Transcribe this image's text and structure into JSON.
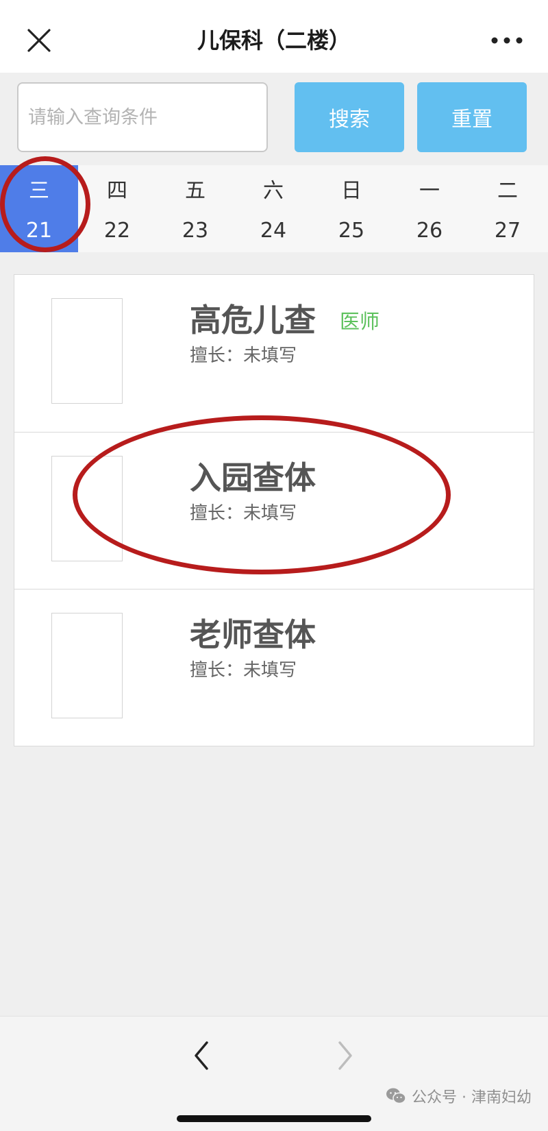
{
  "header": {
    "title": "儿保科（二楼）",
    "close_icon": "close-icon",
    "more_icon": "more-horizontal-icon"
  },
  "search": {
    "placeholder": "请输入查询条件",
    "value": "",
    "search_label": "搜索",
    "reset_label": "重置"
  },
  "dates": [
    {
      "weekday": "三",
      "date": "21",
      "selected": true
    },
    {
      "weekday": "四",
      "date": "22",
      "selected": false
    },
    {
      "weekday": "五",
      "date": "23",
      "selected": false
    },
    {
      "weekday": "六",
      "date": "24",
      "selected": false
    },
    {
      "weekday": "日",
      "date": "25",
      "selected": false
    },
    {
      "weekday": "一",
      "date": "26",
      "selected": false
    },
    {
      "weekday": "二",
      "date": "27",
      "selected": false
    }
  ],
  "doctors": [
    {
      "name": "高危儿查",
      "tag": "医师",
      "specialty": "擅长：未填写"
    },
    {
      "name": "入园查体",
      "tag": "",
      "specialty": "擅长：未填写"
    },
    {
      "name": "老师查体",
      "tag": "",
      "specialty": "擅长：未填写"
    }
  ],
  "footer": {
    "watermark": "公众号 · 津南妇幼",
    "back_icon": "chevron-left-icon",
    "forward_icon": "chevron-right-icon"
  },
  "colors": {
    "accent": "#62bff0",
    "selected_day": "#4f7de8",
    "tag_green": "#5cc15c",
    "annotation_red": "#b71c1c"
  }
}
